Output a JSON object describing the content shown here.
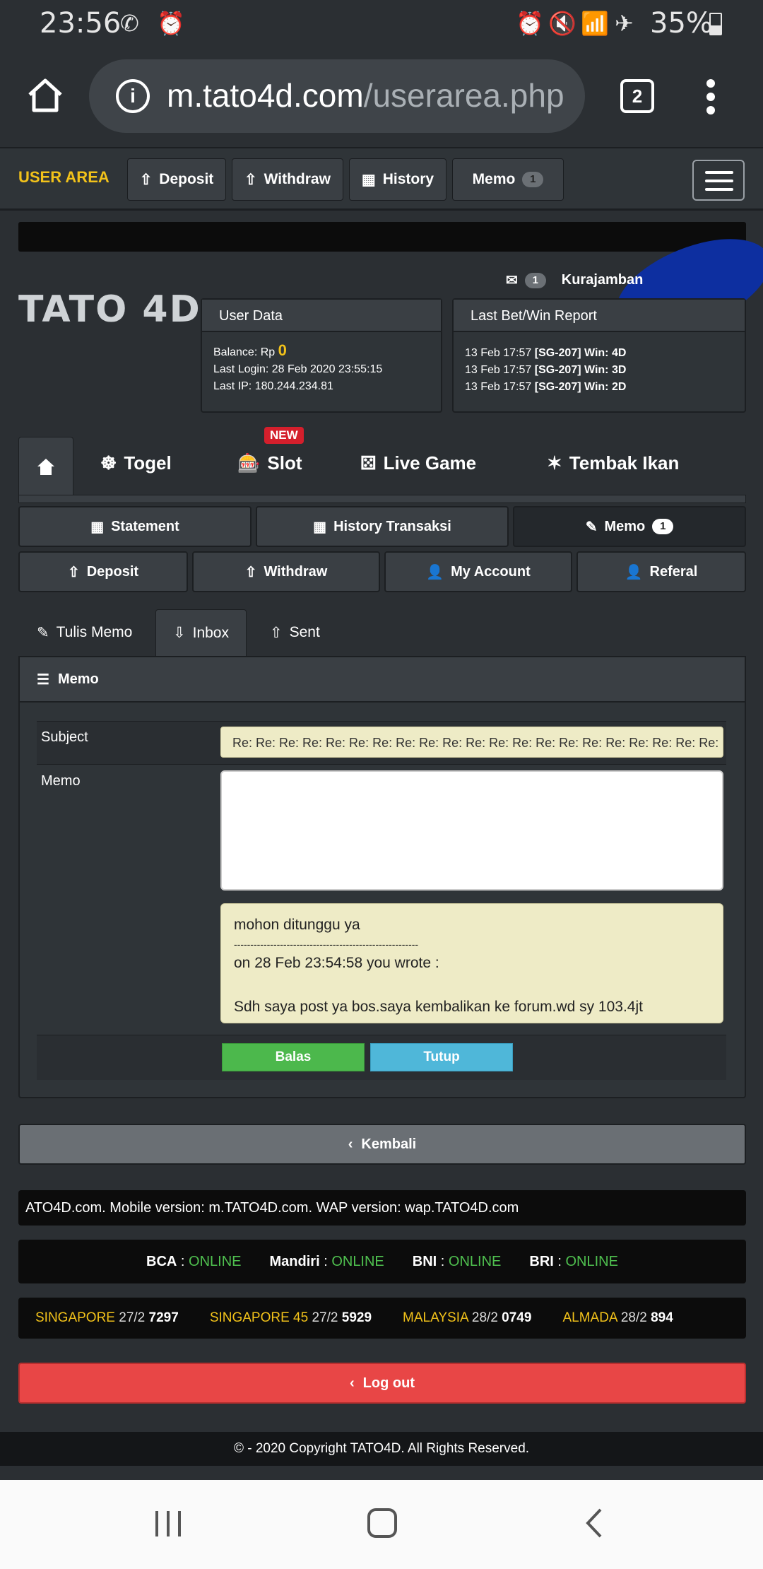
{
  "status_bar": {
    "time": "23:56",
    "battery": "35%",
    "icons": [
      "whatsapp-icon",
      "alarm-icon",
      "alarm-icon",
      "mute-icon",
      "wifi-icon",
      "airplane-icon",
      "battery-icon"
    ]
  },
  "browser": {
    "url_host": "m.tato4d.com",
    "url_path": "/userarea.php",
    "tab_count": "2"
  },
  "topnav": {
    "title": "USER AREA",
    "buttons": [
      {
        "label": "Deposit"
      },
      {
        "label": "Withdraw"
      },
      {
        "label": "History"
      },
      {
        "label": "Memo",
        "badge": "1"
      }
    ]
  },
  "header": {
    "logo": "TATO 4D",
    "mail_count": "1",
    "username": "Kurajamban"
  },
  "user_data": {
    "title": "User Data",
    "balance_label": "Balance: Rp",
    "balance_value": "0",
    "last_login": "Last Login: 28 Feb 2020 23:55:15",
    "last_ip": "Last IP: 180.244.234.81"
  },
  "bet_report": {
    "title": "Last Bet/Win Report",
    "rows": [
      {
        "date": "13 Feb 17:57",
        "game": "[SG-207] Win: 4D"
      },
      {
        "date": "13 Feb 17:57",
        "game": "[SG-207] Win: 3D"
      },
      {
        "date": "13 Feb 17:57",
        "game": "[SG-207] Win: 2D"
      }
    ]
  },
  "game_tabs": {
    "new_tag": "NEW",
    "items": [
      {
        "label": "Togel"
      },
      {
        "label": "Slot"
      },
      {
        "label": "Live Game"
      },
      {
        "label": "Tembak Ikan"
      }
    ]
  },
  "actions": {
    "row1": [
      {
        "label": "Statement"
      },
      {
        "label": "History Transaksi"
      },
      {
        "label": "Memo",
        "badge": "1"
      }
    ],
    "row2": [
      {
        "label": "Deposit"
      },
      {
        "label": "Withdraw"
      },
      {
        "label": "My Account"
      },
      {
        "label": "Referal"
      }
    ]
  },
  "memo_tabs": [
    {
      "label": "Tulis Memo"
    },
    {
      "label": "Inbox"
    },
    {
      "label": "Sent"
    }
  ],
  "memo": {
    "title": "Memo",
    "subject_label": "Subject",
    "subject_value": "Re: Re: Re: Re: Re: Re: Re: Re: Re: Re: Re: Re: Re: Re: Re: Re: Re: Re: Re: Re: Re:",
    "memo_label": "Memo",
    "memo_value": "",
    "quote_line1": "mohon ditunggu ya",
    "quote_divider": "--------------------------------------------------------",
    "quote_line2": "on 28 Feb 23:54:58 you wrote :",
    "quote_line3": "Sdh saya post ya bos.saya kembalikan ke forum.wd sy 103.4jt",
    "reply_button": "Balas",
    "close_button": "Tutup"
  },
  "back_button": "Kembali",
  "marquee": "ATO4D.com. Mobile version: m.TATO4D.com. WAP version: wap.TATO4D.com",
  "banks": [
    {
      "name": "BCA",
      "status": "ONLINE"
    },
    {
      "name": "Mandiri",
      "status": "ONLINE"
    },
    {
      "name": "BNI",
      "status": "ONLINE"
    },
    {
      "name": "BRI",
      "status": "ONLINE"
    }
  ],
  "results": [
    {
      "name": "SINGAPORE",
      "date": "27/2",
      "number": "7297"
    },
    {
      "name": "SINGAPORE 45",
      "date": "27/2",
      "number": "5929"
    },
    {
      "name": "MALAYSIA",
      "date": "28/2",
      "number": "0749"
    },
    {
      "name": "ALMADA",
      "date": "28/2",
      "number": "894"
    }
  ],
  "logout_button": "Log out",
  "footer": "© - 2020 Copyright TATO4D. All Rights Reserved.",
  "colors": {
    "accent_yellow": "#f2c21a",
    "online_green": "#4fc04f",
    "logout_red": "#e84646",
    "reply_green": "#4cb84c",
    "close_blue": "#4fb7d9"
  }
}
